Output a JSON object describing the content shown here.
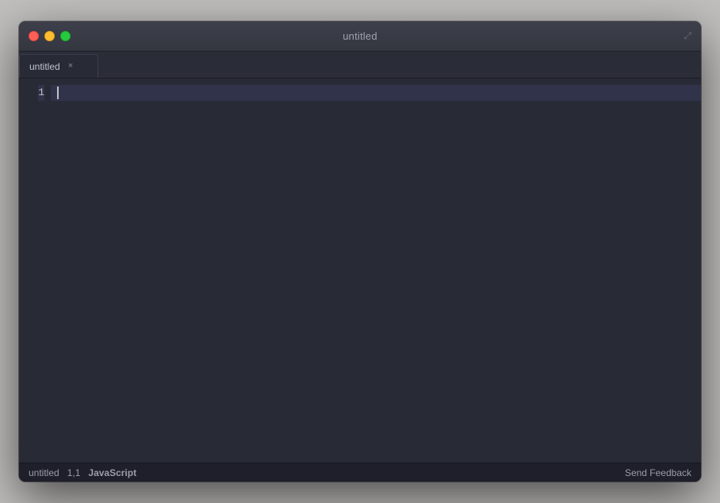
{
  "window": {
    "title": "untitled",
    "fullscreen_icon": "⤢"
  },
  "traffic_lights": {
    "close_label": "close",
    "minimize_label": "minimize",
    "maximize_label": "maximize"
  },
  "tab": {
    "label": "untitled",
    "close_label": "×"
  },
  "editor": {
    "line_numbers": [
      "1"
    ],
    "active_line": 1
  },
  "status_bar": {
    "filename": "untitled",
    "position": "1,1",
    "language": "JavaScript",
    "feedback_label": "Send Feedback"
  }
}
